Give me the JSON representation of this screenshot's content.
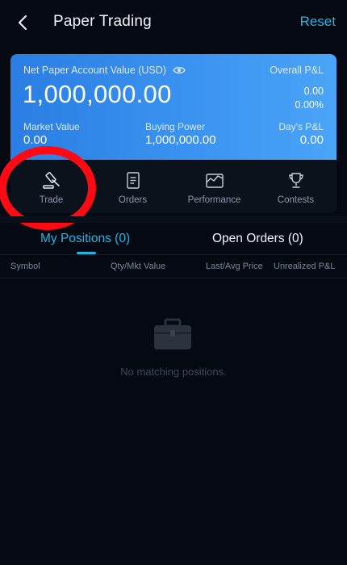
{
  "header": {
    "title": "Paper Trading",
    "reset_label": "Reset"
  },
  "account": {
    "net_value_label": "Net Paper Account Value (USD)",
    "net_value": "1,000,000.00",
    "overall_pl_label": "Overall P&L",
    "overall_pl_value": "0.00",
    "overall_pl_pct": "0.00%",
    "market_value_label": "Market Value",
    "market_value": "0.00",
    "buying_power_label": "Buying Power",
    "buying_power": "1,000,000.00",
    "days_pl_label": "Day's P&L",
    "days_pl": "0.00"
  },
  "menu": {
    "items": [
      {
        "label": "Trade",
        "icon": "gavel-icon"
      },
      {
        "label": "Orders",
        "icon": "document-icon"
      },
      {
        "label": "Performance",
        "icon": "chart-icon"
      },
      {
        "label": "Contests",
        "icon": "trophy-icon"
      }
    ]
  },
  "tabs": {
    "positions": "My Positions (0)",
    "orders": "Open Orders (0)",
    "active": "positions"
  },
  "columns": {
    "symbol": "Symbol",
    "qty": "Qty/Mkt Value",
    "last": "Last/Avg Price",
    "unrealized": "Unrealized P&L"
  },
  "empty": {
    "message": "No matching positions.",
    "icon": "briefcase-icon"
  },
  "colors": {
    "accent": "#1fb6e6",
    "background": "#050a12",
    "card_gradient_start": "#2a7ee3",
    "card_gradient_end": "#4aa4f7",
    "annotation_ring": "#ff0a14"
  }
}
